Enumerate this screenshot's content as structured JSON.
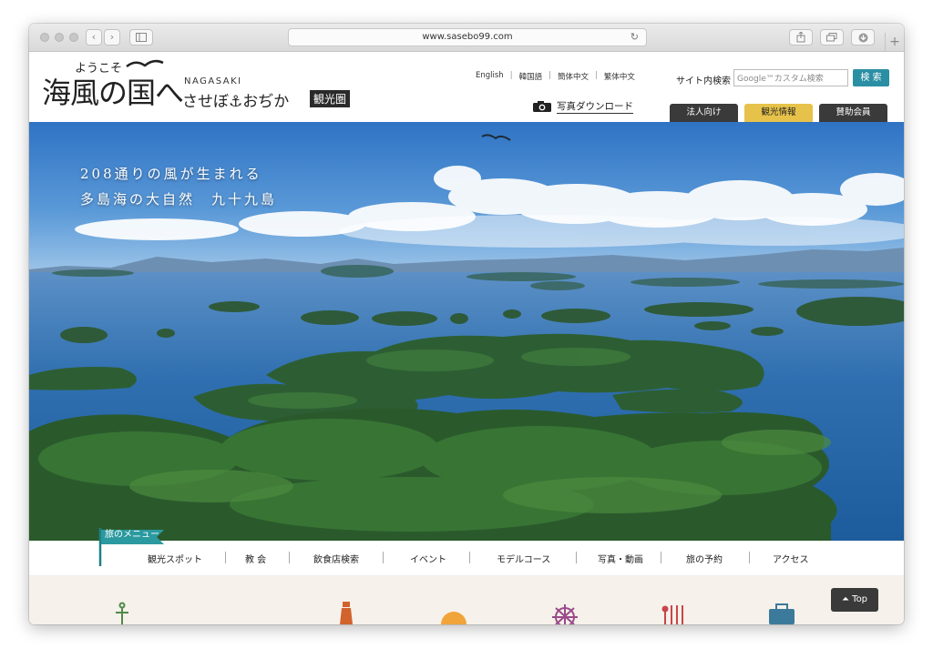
{
  "browser": {
    "url": "www.sasebo99.com"
  },
  "header": {
    "logo_top": "ようこそ",
    "logo_main": "海風の国へ",
    "logo_region": "NAGASAKI",
    "logo_name": "させぼ⚓おぢか",
    "logo_badge": "観光圏",
    "languages": [
      "English",
      "韓国語",
      "簡体中文",
      "繁体中文"
    ],
    "site_search_label": "サイト内検索",
    "site_search_placeholder": "Google™カスタム検索",
    "search_button": "検 索",
    "photo_download": "写真ダウンロード",
    "tabs": [
      {
        "label": "法人向け",
        "active": false
      },
      {
        "label": "観光情報",
        "active": true
      },
      {
        "label": "賛助会員",
        "active": false
      }
    ]
  },
  "hero": {
    "line1": "208通りの風が生まれる",
    "line2": "多島海の大自然　九十九島"
  },
  "menu": {
    "flag_label": "旅のメニュー",
    "items": [
      "観光スポット",
      "教 会",
      "飲食店検索",
      "イベント",
      "モデルコース",
      "写真・動画",
      "旅の予約",
      "アクセス"
    ]
  },
  "back_to_top": "Top",
  "colors": {
    "accent_teal": "#2b8fa4",
    "tab_active": "#e6c24a",
    "tab_dark": "#3a3a3a"
  }
}
